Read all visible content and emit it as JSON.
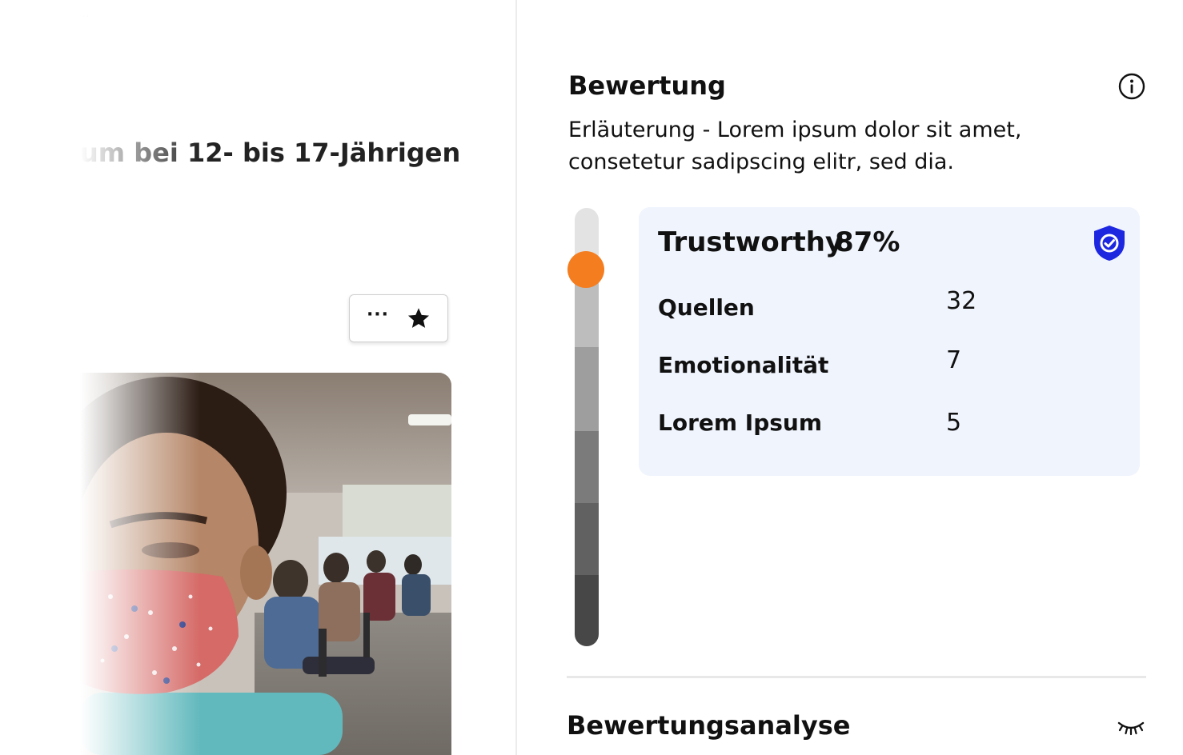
{
  "left": {
    "top_dots": "...",
    "article_title": "um bei 12- bis 17-Jährigen",
    "action_more": "···",
    "icons": {
      "more": "more-horizontal-icon",
      "star": "star-icon"
    }
  },
  "rating": {
    "heading": "Bewertung",
    "description": "Erläuterung - Lorem ipsum dolor sit amet, consetetur sadipscing elitr, sed dia.",
    "info_icon": "info-icon",
    "scale_position": 0.1,
    "card": {
      "label": "Trustworthy",
      "value": "87%",
      "badge_icon": "shield-check-icon",
      "metrics": [
        {
          "label": "Quellen",
          "value": "32"
        },
        {
          "label": "Emotionalität",
          "value": "7"
        },
        {
          "label": "Lorem Ipsum",
          "value": "5"
        }
      ]
    }
  },
  "analysis": {
    "heading": "Bewertungsanalyse",
    "toggle_icon": "eye-closed-icon"
  },
  "colors": {
    "accent_knob": "#f47d20",
    "card_background": "#f0f4fd",
    "shield": "#1d27e0",
    "scale_segments": [
      "#e3e3e3",
      "#bdbdbd",
      "#9e9e9e",
      "#7b7b7b",
      "#616161",
      "#474747"
    ]
  }
}
